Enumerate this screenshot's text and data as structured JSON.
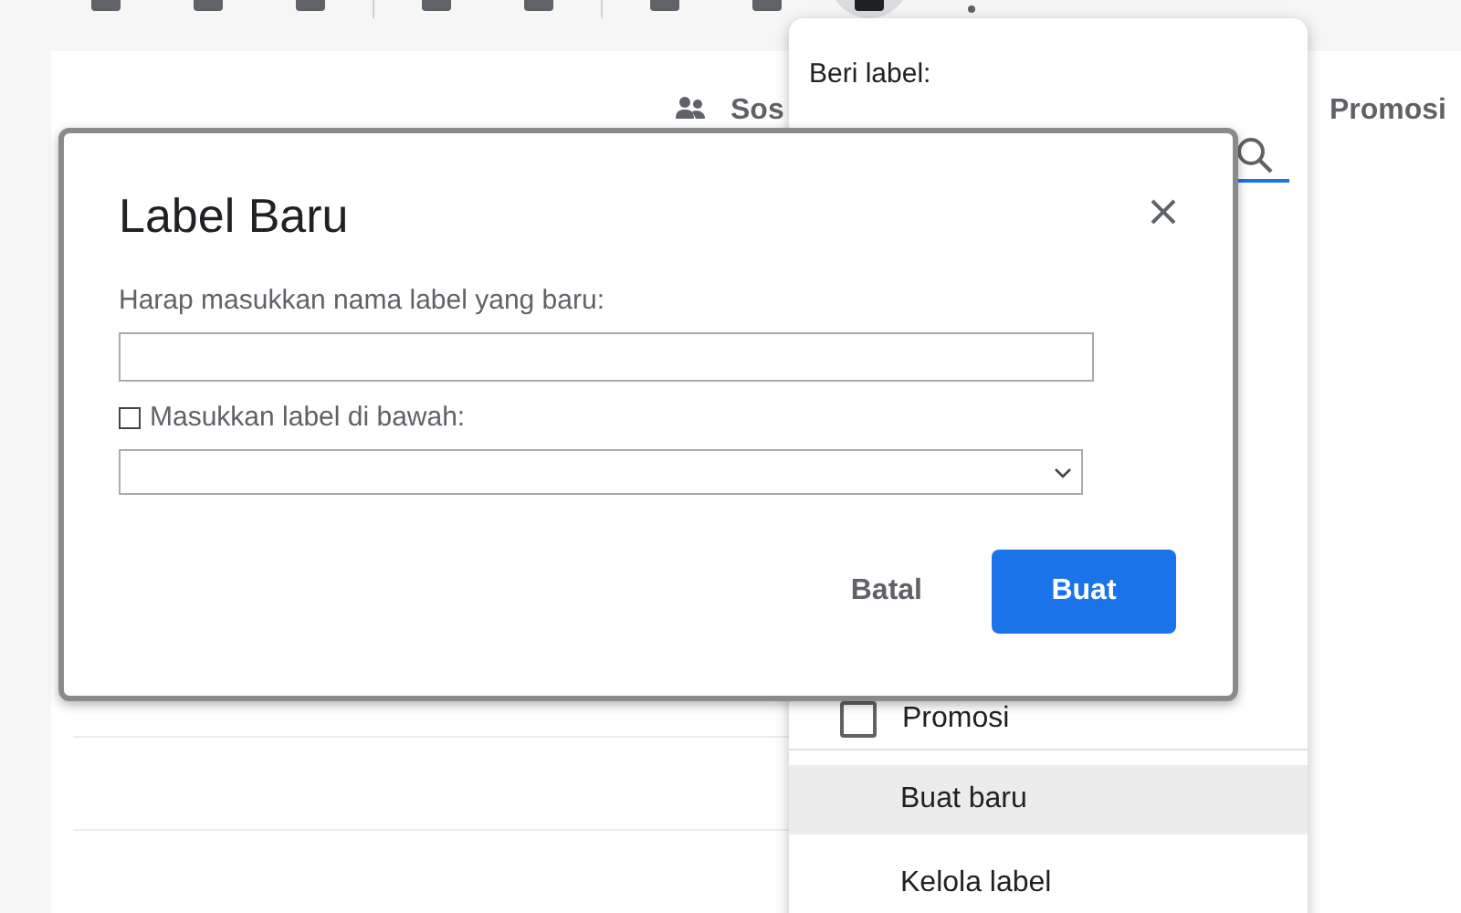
{
  "toolbar": {
    "buttons": [
      {
        "selected": false
      },
      {
        "selected": false
      },
      {
        "selected": false
      },
      {
        "selected": false
      },
      {
        "selected": false
      },
      {
        "selected": false
      },
      {
        "selected": false
      },
      {
        "selected": true
      }
    ]
  },
  "tabs": [
    {
      "label": "Sos",
      "selected": false
    },
    {
      "label": "Promosi",
      "selected": false
    }
  ],
  "label_menu": {
    "title": "Beri label:",
    "items": [
      {
        "label": "Promosi",
        "checked": false
      }
    ],
    "actions": [
      {
        "label": "Buat baru",
        "selected": true
      },
      {
        "label": "Kelola label",
        "selected": false
      }
    ]
  },
  "dialog": {
    "title": "Label Baru",
    "name_label": "Harap masukkan nama label yang baru:",
    "nest": {
      "label": "Masukkan label di bawah:",
      "checked": false
    },
    "buttons": [
      {
        "label": "Batal",
        "kind": "text"
      },
      {
        "label": "Buat",
        "kind": "primary"
      }
    ]
  }
}
